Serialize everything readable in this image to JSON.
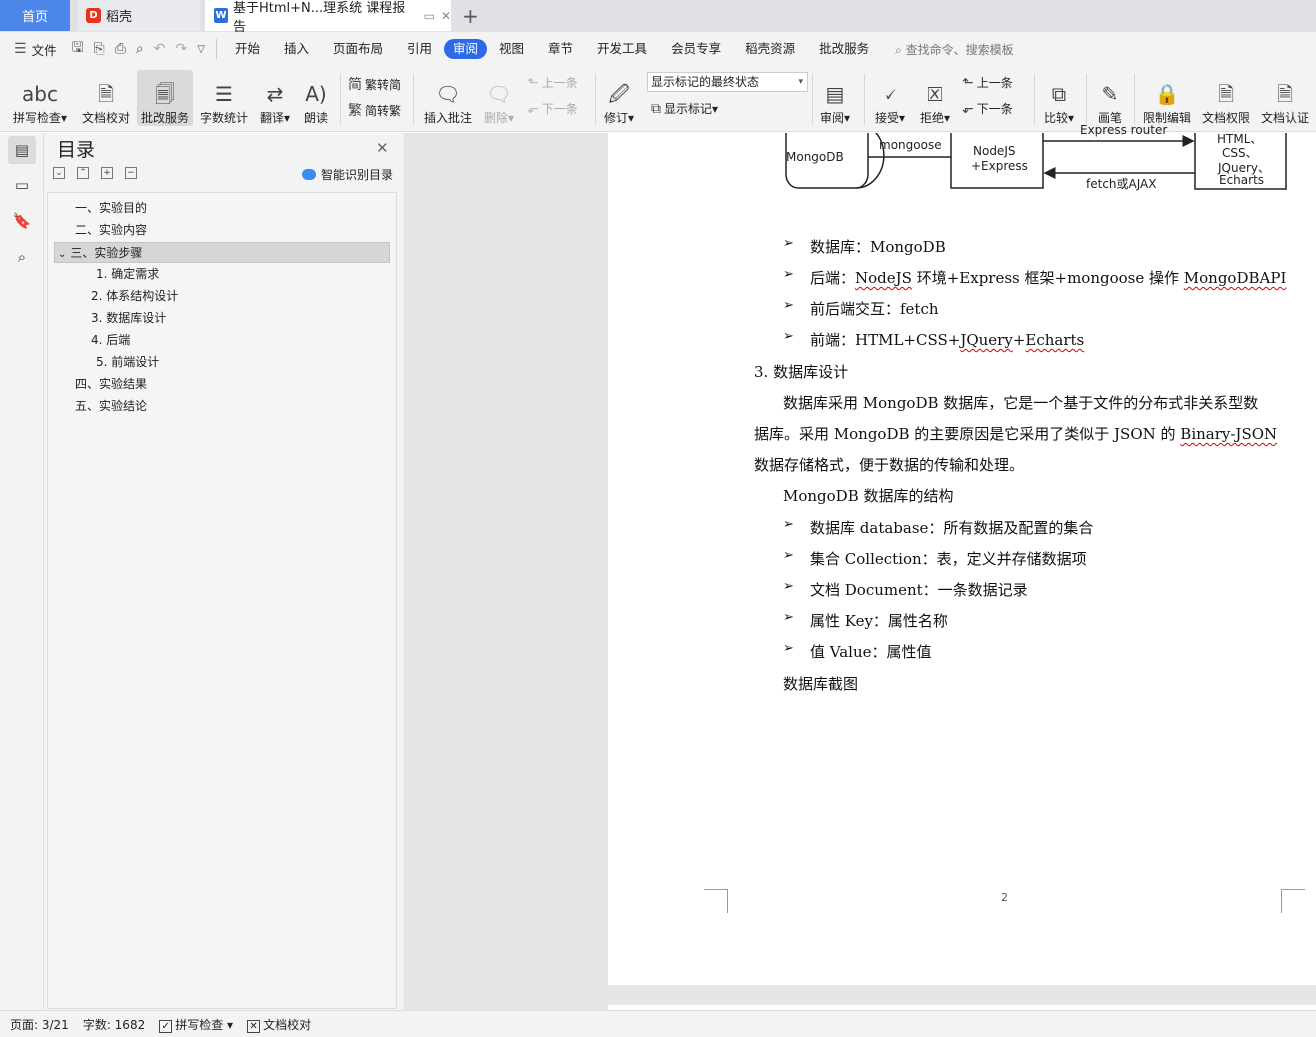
{
  "tabs": {
    "home": "首页",
    "docer": "稻壳",
    "doc": "基于Html+N...理系统 课程报告",
    "docer_logo": "D",
    "doc_logo": "W"
  },
  "menu": {
    "file": "文件",
    "items": [
      "开始",
      "插入",
      "页面布局",
      "引用",
      "审阅",
      "视图",
      "章节",
      "开发工具",
      "会员专享",
      "稻壳资源",
      "批改服务"
    ],
    "active": "审阅",
    "search": "查找命令、搜索模板"
  },
  "ribbon": {
    "spellcheck": "拼写检查",
    "doc_proof": "文档校对",
    "correct_service": "批改服务",
    "word_count": "字数统计",
    "translate": "翻译",
    "read_aloud": "朗读",
    "trad_to_simp": "繁转简",
    "simp_to_trad": "简转繁",
    "insert_comment": "插入批注",
    "delete": "删除",
    "prev_comment": "上一条",
    "next_comment": "下一条",
    "track_changes": "修订",
    "markup_state": "显示标记的最终状态",
    "show_markup": "显示标记",
    "review": "审阅",
    "accept": "接受",
    "reject": "拒绝",
    "prev_change": "上一条",
    "next_change": "下一条",
    "compare": "比较",
    "ink": "画笔",
    "restrict_edit": "限制编辑",
    "doc_permission": "文档权限",
    "doc_certify": "文档认证"
  },
  "toc": {
    "title": "目录",
    "smart": "智能识别目录",
    "items": [
      "一、实验目的",
      "二、实验内容",
      "三、实验步骤",
      "1. 确定需求",
      "2. 体系结构设计",
      "3. 数据库设计",
      "4. 后端",
      "5. 前端设计",
      "四、实验结果",
      "五、实验结论"
    ],
    "selected": "三、实验步骤"
  },
  "diagram": {
    "mongodb": "MongoDB",
    "mongoose": "mongoose",
    "nodejs_line1": "NodeJS",
    "nodejs_line2": "+Express",
    "express_router": "Express router",
    "fetch": "fetch或AJAX",
    "front_lines": [
      "HTML、",
      "CSS、",
      "JQuery、",
      "Echarts"
    ]
  },
  "document": {
    "bullets1": [
      "数据库：MongoDB",
      "后端：NodeJS 环境+Express 框架+mongoose 操作 MongoDBAPI",
      "前后端交互：fetch",
      "前端：HTML+CSS+JQuery+Echarts"
    ],
    "heading": "3. 数据库设计",
    "para_line1": "数据库采用 MongoDB 数据库，它是一个基于文件的分布式非关系型数",
    "para_line2": "据库。采用 MongoDB 的主要原因是它采用了类似于 JSON 的 Binary-JSON",
    "para_line3": "数据存储格式，便于数据的传输和处理。",
    "structure_title": "MongoDB 数据库的结构",
    "bullets2": [
      "数据库 database：所有数据及配置的集合",
      "集合 Collection：表，定义并存储数据项",
      "文档 Document：一条数据记录",
      "属性 Key：属性名称",
      "值 Value：属性值"
    ],
    "screenshot_caption": "数据库截图",
    "page_number": "2",
    "bullet_glyph": "➢"
  },
  "status": {
    "page": "页面: 3/21",
    "words": "字数: 1682",
    "spellcheck": "拼写检查",
    "proof": "文档校对"
  },
  "colors": {
    "accent": "#2c6ae8",
    "home_tab": "#4c86e8",
    "docer_logo": "#e5331d",
    "spell_error": "#d00000"
  }
}
